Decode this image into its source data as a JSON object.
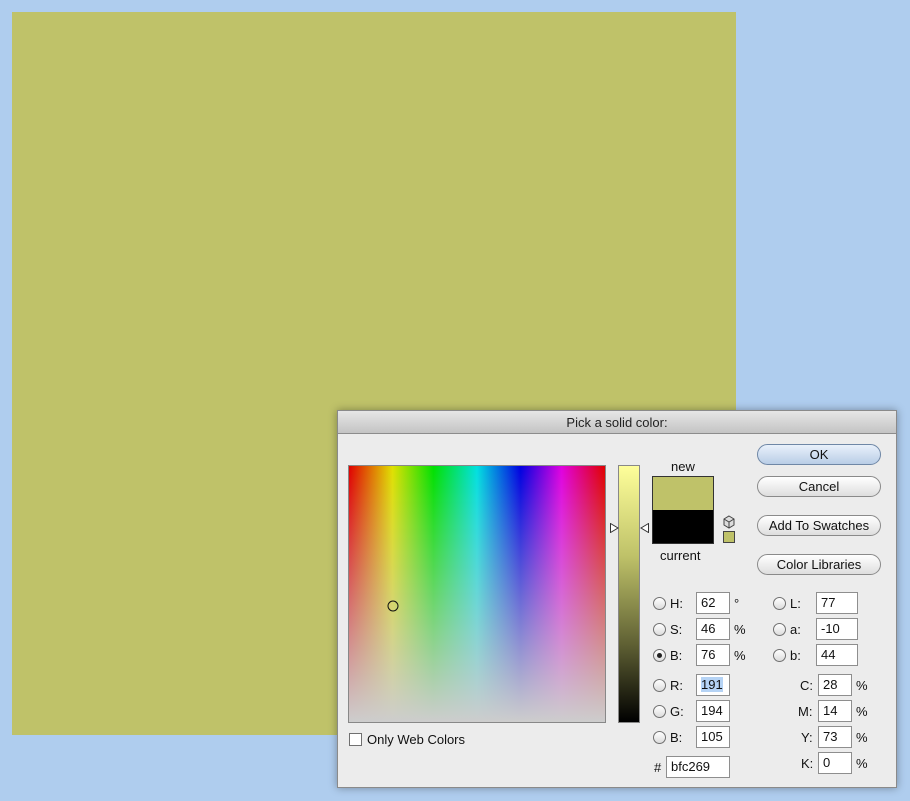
{
  "colors": {
    "desktop": "#afcdee",
    "new_color": "#bfc269",
    "current_color": "#000000"
  },
  "dialog": {
    "title": "Pick a solid color:",
    "new_label": "new",
    "current_label": "current",
    "only_web_colors": {
      "label": "Only Web Colors",
      "checked": false
    }
  },
  "buttons": {
    "ok": "OK",
    "cancel": "Cancel",
    "add_to_swatches": "Add To Swatches",
    "color_libraries": "Color Libraries"
  },
  "hsb": {
    "h": {
      "label": "H:",
      "value": "62",
      "unit": "°",
      "selected": false
    },
    "s": {
      "label": "S:",
      "value": "46",
      "unit": "%",
      "selected": false
    },
    "b": {
      "label": "B:",
      "value": "76",
      "unit": "%",
      "selected": true
    }
  },
  "rgb": {
    "r": {
      "label": "R:",
      "value": "191"
    },
    "g": {
      "label": "G:",
      "value": "194"
    },
    "b": {
      "label": "B:",
      "value": "105"
    }
  },
  "lab": {
    "l": {
      "label": "L:",
      "value": "77"
    },
    "a": {
      "label": "a:",
      "value": "-10"
    },
    "b": {
      "label": "b:",
      "value": "44"
    }
  },
  "cmyk": {
    "c": {
      "label": "C:",
      "value": "28",
      "unit": "%"
    },
    "m": {
      "label": "M:",
      "value": "14",
      "unit": "%"
    },
    "y": {
      "label": "Y:",
      "value": "73",
      "unit": "%"
    },
    "k": {
      "label": "K:",
      "value": "0",
      "unit": "%"
    }
  },
  "hex": {
    "label": "#",
    "value": "bfc269"
  },
  "icons": [
    "gamut-cube-icon",
    "web-safe-swatch-icon",
    "field-cursor-icon",
    "slider-arrow-icon"
  ]
}
